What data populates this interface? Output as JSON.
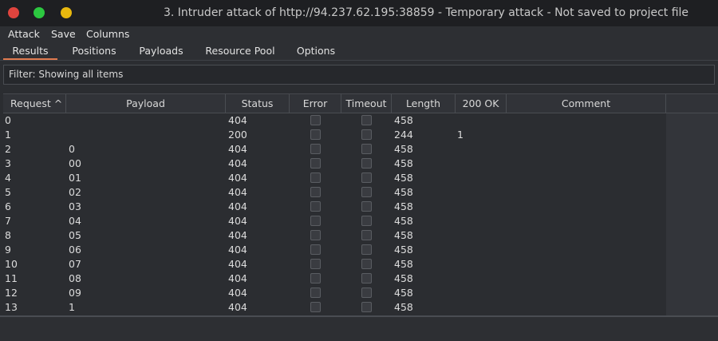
{
  "window": {
    "title": "3. Intruder attack of http://94.237.62.195:38859 - Temporary attack - Not saved to project file",
    "traffic_lights": {
      "close": "#e0443e",
      "minimize": "#2cc840",
      "zoom": "#e8b80e"
    }
  },
  "menu": [
    "Attack",
    "Save",
    "Columns"
  ],
  "tabs": [
    "Results",
    "Positions",
    "Payloads",
    "Resource Pool",
    "Options"
  ],
  "active_tab": "Results",
  "accent_color": "#e07a4f",
  "filter": {
    "text": "Filter: Showing all items"
  },
  "table": {
    "columns": [
      "Request ^",
      "Payload",
      "Status",
      "Error",
      "Timeout",
      "Length",
      "200 OK",
      "Comment"
    ],
    "sort": {
      "column": "Request",
      "direction": "ascending"
    },
    "rows": [
      {
        "request": "0",
        "payload": "",
        "status": "404",
        "error": false,
        "timeout": false,
        "length": "458",
        "ok200": ""
      },
      {
        "request": "1",
        "payload": "",
        "status": "200",
        "error": false,
        "timeout": false,
        "length": "244",
        "ok200": "1"
      },
      {
        "request": "2",
        "payload": "0",
        "status": "404",
        "error": false,
        "timeout": false,
        "length": "458",
        "ok200": ""
      },
      {
        "request": "3",
        "payload": "00",
        "status": "404",
        "error": false,
        "timeout": false,
        "length": "458",
        "ok200": ""
      },
      {
        "request": "4",
        "payload": "01",
        "status": "404",
        "error": false,
        "timeout": false,
        "length": "458",
        "ok200": ""
      },
      {
        "request": "5",
        "payload": "02",
        "status": "404",
        "error": false,
        "timeout": false,
        "length": "458",
        "ok200": ""
      },
      {
        "request": "6",
        "payload": "03",
        "status": "404",
        "error": false,
        "timeout": false,
        "length": "458",
        "ok200": ""
      },
      {
        "request": "7",
        "payload": "04",
        "status": "404",
        "error": false,
        "timeout": false,
        "length": "458",
        "ok200": ""
      },
      {
        "request": "8",
        "payload": "05",
        "status": "404",
        "error": false,
        "timeout": false,
        "length": "458",
        "ok200": ""
      },
      {
        "request": "9",
        "payload": "06",
        "status": "404",
        "error": false,
        "timeout": false,
        "length": "458",
        "ok200": ""
      },
      {
        "request": "10",
        "payload": "07",
        "status": "404",
        "error": false,
        "timeout": false,
        "length": "458",
        "ok200": ""
      },
      {
        "request": "11",
        "payload": "08",
        "status": "404",
        "error": false,
        "timeout": false,
        "length": "458",
        "ok200": ""
      },
      {
        "request": "12",
        "payload": "09",
        "status": "404",
        "error": false,
        "timeout": false,
        "length": "458",
        "ok200": ""
      },
      {
        "request": "13",
        "payload": "1",
        "status": "404",
        "error": false,
        "timeout": false,
        "length": "458",
        "ok200": ""
      }
    ]
  }
}
